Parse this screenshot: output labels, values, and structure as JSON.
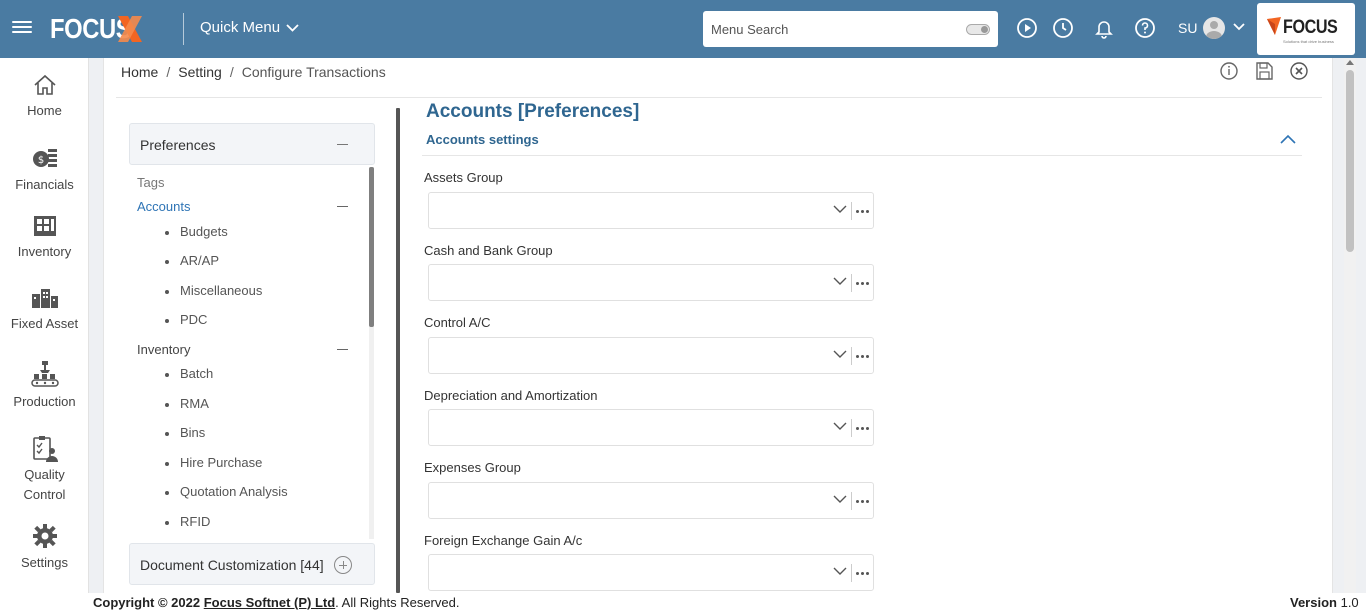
{
  "topbar": {
    "logo_text": "FOCUS",
    "quick_menu_label": "Quick Menu",
    "search_placeholder": "Menu Search",
    "user_initials": "SU",
    "brand_text": "FOCUS",
    "brand_tagline": "Solutions that drive business",
    "bg_color": "#4a7ba2"
  },
  "leftnav": {
    "items": [
      {
        "label": "Home",
        "icon": "home-icon"
      },
      {
        "label": "Financials",
        "icon": "coins-icon"
      },
      {
        "label": "Inventory",
        "icon": "warehouse-icon"
      },
      {
        "label": "Fixed Asset",
        "icon": "buildings-icon"
      },
      {
        "label": "Production",
        "icon": "conveyor-icon"
      },
      {
        "label": "Quality",
        "label2": "Control",
        "icon": "clipboard-user-icon"
      },
      {
        "label": "Settings",
        "icon": "gear-icon"
      }
    ]
  },
  "breadcrumb": {
    "home": "Home",
    "setting": "Setting",
    "current": "Configure Transactions",
    "sep": "/"
  },
  "tree": {
    "header": "Preferences",
    "tags_label": "Tags",
    "accounts": {
      "label": "Accounts",
      "children": [
        "Budgets",
        "AR/AP",
        "Miscellaneous",
        "PDC"
      ]
    },
    "inventory": {
      "label": "Inventory",
      "children": [
        "Batch",
        "RMA",
        "Bins",
        "Hire Purchase",
        "Quotation Analysis",
        "RFID"
      ]
    },
    "doc_customization": "Document Customization [44]"
  },
  "form": {
    "title": "Accounts [Preferences]",
    "section": "Accounts settings",
    "fields": [
      {
        "label": "Assets Group",
        "value": ""
      },
      {
        "label": "Cash and Bank Group",
        "value": ""
      },
      {
        "label": "Control A/C",
        "value": ""
      },
      {
        "label": "Depreciation and Amortization",
        "value": ""
      },
      {
        "label": "Expenses Group",
        "value": ""
      },
      {
        "label": "Foreign Exchange Gain A/c",
        "value": ""
      }
    ]
  },
  "footer": {
    "copyright_prefix": "Copyright © 2022",
    "company": "Focus Softnet (P) Ltd",
    "rights": ". All Rights Reserved.",
    "version_label": "Version",
    "version_value": "1.0"
  },
  "colors": {
    "accent": "#2f6690",
    "link": "#2e74b5",
    "brand_orange": "#f26522"
  }
}
